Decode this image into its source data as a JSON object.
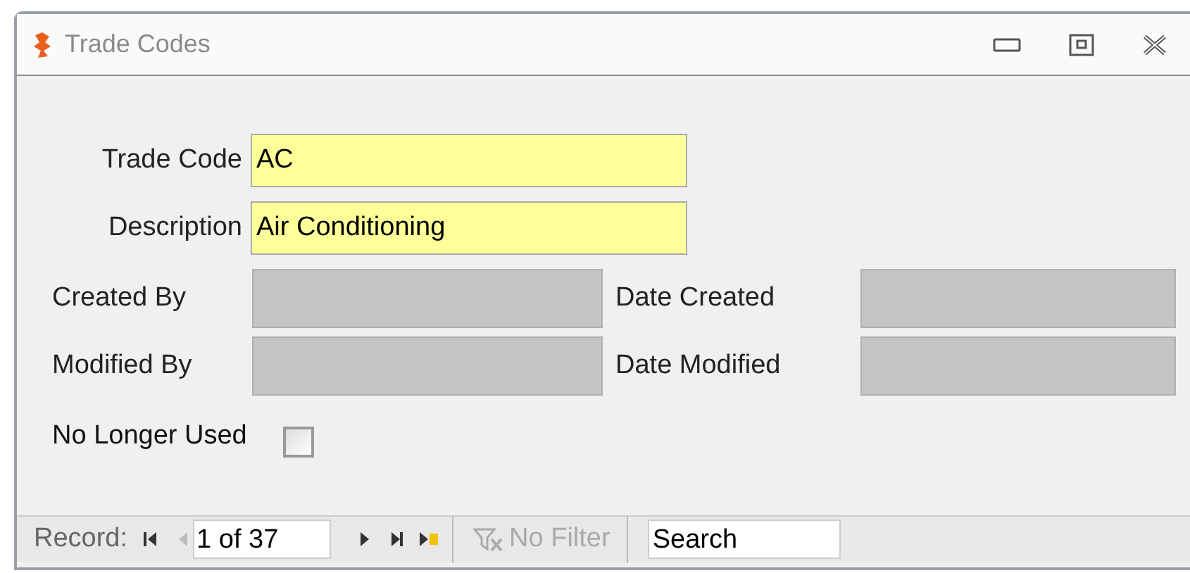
{
  "window": {
    "title": "Trade Codes"
  },
  "fields": [
    {
      "label": "Trade Code",
      "value": "AC"
    },
    {
      "label": "Description",
      "value": "Air Conditioning"
    }
  ],
  "audit": [
    {
      "label": "Created By",
      "date_label": "Date Created"
    },
    {
      "label": "Modified By",
      "date_label": "Date Modified"
    }
  ],
  "no_longer_used": {
    "label": "No Longer Used",
    "checked": false
  },
  "navigation": {
    "label": "Record:",
    "position": "1 of 37",
    "prev_disabled": true,
    "filter": "No Filter",
    "filter_disabled": true,
    "search": "Search"
  }
}
